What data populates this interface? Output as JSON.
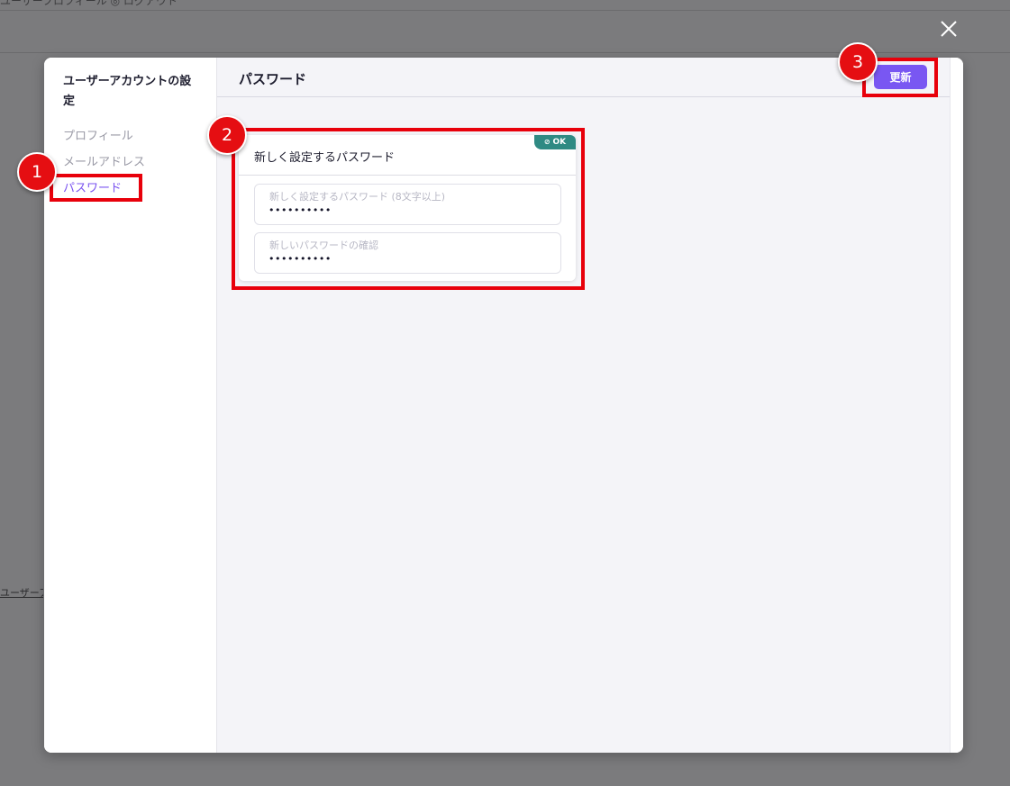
{
  "background": {
    "top_text": "ユーザープロフィール ◎ ログアウト",
    "footer_link": "ユーザーアプリ"
  },
  "modal": {
    "close_icon": "close-icon",
    "sidebar": {
      "title": "ユーザーアカウントの設定",
      "items": [
        {
          "label": "プロフィール",
          "active": false
        },
        {
          "label": "メールアドレス",
          "active": false
        },
        {
          "label": "パスワード",
          "active": true
        }
      ]
    },
    "main": {
      "title": "パスワード",
      "update_button": "更新",
      "card": {
        "title": "新しく設定するパスワード",
        "badge": "OK",
        "badge_icon": "check-circle-icon",
        "fields": [
          {
            "label": "新しく設定するパスワード (8文字以上)",
            "value": "••••••••••"
          },
          {
            "label": "新しいパスワードの確認",
            "value": "••••••••••"
          }
        ]
      }
    }
  },
  "annotations": {
    "markers": [
      "1",
      "2",
      "3"
    ]
  },
  "colors": {
    "accent": "#7957f2",
    "active_nav": "#7b55f0",
    "ok_badge": "#2f8a83",
    "annotation_red": "#e8000b"
  }
}
